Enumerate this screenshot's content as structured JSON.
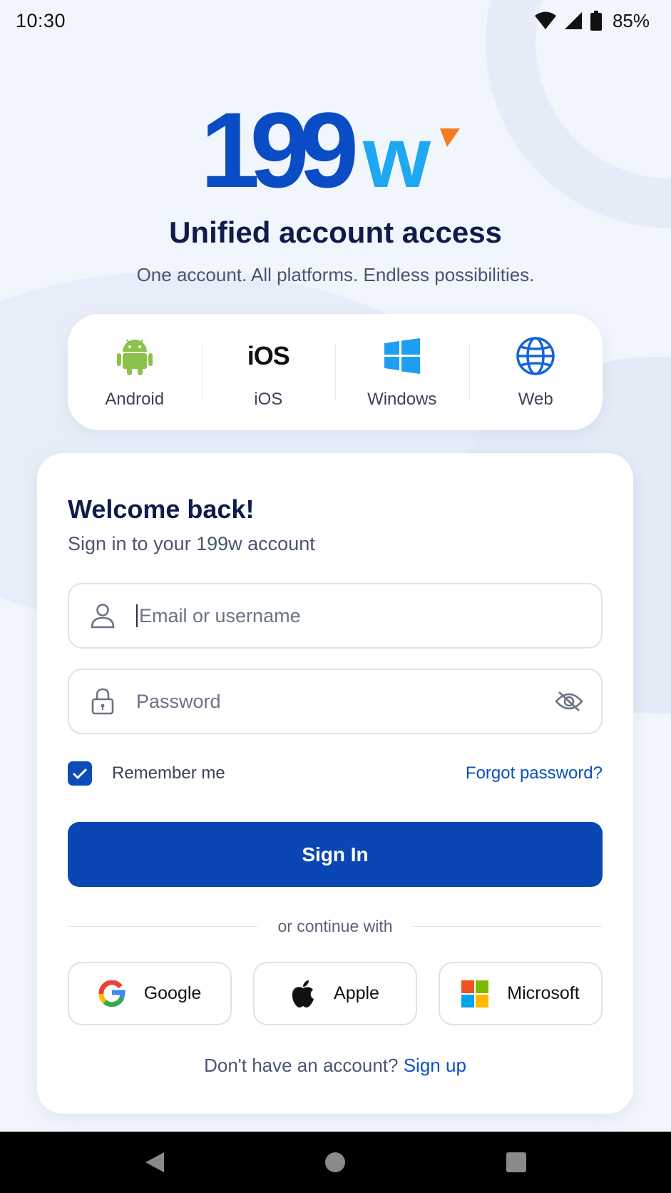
{
  "status_bar": {
    "time": "10:30",
    "battery": "85%"
  },
  "brand": {
    "logo_numeral": "199",
    "logo_letter": "w"
  },
  "hero": {
    "title": "Unified account access",
    "subtitle": "One account. All platforms. Endless possibilities."
  },
  "platforms": [
    {
      "label": "Android",
      "icon": "android-icon"
    },
    {
      "label": "iOS",
      "icon_text": "iOS"
    },
    {
      "label": "Windows",
      "icon": "windows-icon"
    },
    {
      "label": "Web",
      "icon": "globe-icon"
    }
  ],
  "login": {
    "title": "Welcome back!",
    "subtitle": "Sign in to your 199w account",
    "email_placeholder": "Email or username",
    "password_placeholder": "Password",
    "remember_label": "Remember me",
    "remember_checked": true,
    "forgot_label": "Forgot password?",
    "signin_label": "Sign In",
    "divider_text": "or continue with",
    "social": [
      {
        "label": "Google",
        "icon": "google-icon"
      },
      {
        "label": "Apple",
        "icon": "apple-icon"
      },
      {
        "label": "Microsoft",
        "icon": "microsoft-icon"
      }
    ],
    "signup_prompt": "Don't have an account?",
    "signup_link": "Sign up"
  },
  "colors": {
    "primary": "#0a47b5",
    "link": "#0b4fc2",
    "logo_dark": "#0a4cc4",
    "logo_light": "#1ea8f2",
    "logo_accent": "#f47c20",
    "android": "#8bc34a",
    "windows": "#1e9ef0",
    "globe": "#1565d8"
  }
}
